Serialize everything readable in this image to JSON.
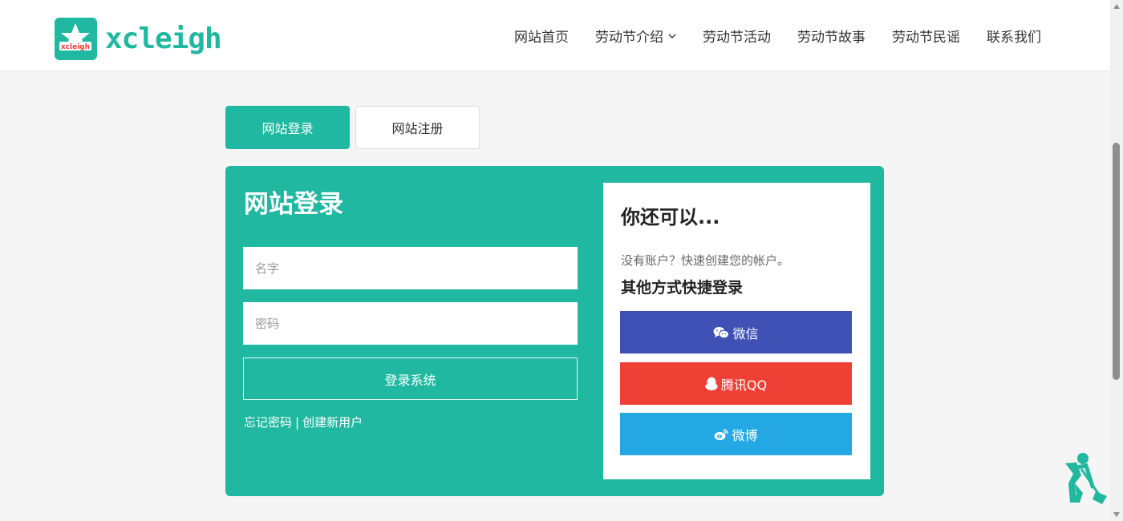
{
  "brand": {
    "logo_text": "xcleigh",
    "logo_badge_text": "xcleigh",
    "accent": "#20b8a0"
  },
  "nav": {
    "items": [
      {
        "label": "网站首页"
      },
      {
        "label": "劳动节介绍",
        "has_dropdown": true
      },
      {
        "label": "劳动节活动"
      },
      {
        "label": "劳动节故事"
      },
      {
        "label": "劳动节民谣"
      },
      {
        "label": "联系我们"
      }
    ]
  },
  "tabs": [
    {
      "label": "网站登录",
      "active": true
    },
    {
      "label": "网站注册",
      "active": false
    }
  ],
  "login": {
    "title": "网站登录",
    "name_placeholder": "名字",
    "password_placeholder": "密码",
    "submit_label": "登录系统",
    "forgot_label": "忘记密码",
    "separator": "|",
    "create_label": "创建新用户"
  },
  "side": {
    "title": "你还可以...",
    "desc": "没有账户？快速创建您的帐户。",
    "subtitle": "其他方式快捷登录",
    "buttons": [
      {
        "label": "微信",
        "icon": "wechat-icon",
        "color": "#3f51b5"
      },
      {
        "label": "腾讯QQ",
        "icon": "qq-icon",
        "color": "#ef4036"
      },
      {
        "label": "微博",
        "icon": "weibo-icon",
        "color": "#24a8e4"
      }
    ]
  }
}
